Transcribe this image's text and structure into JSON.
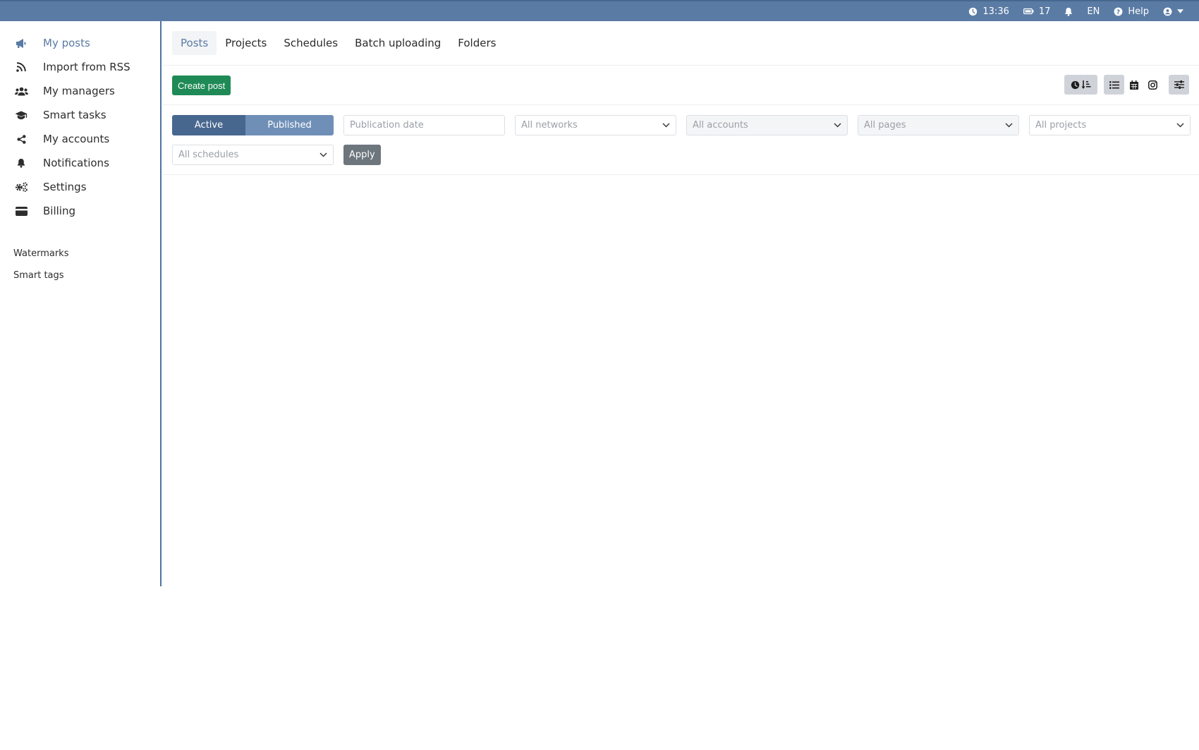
{
  "topbar": {
    "time": "13:36",
    "credits": "17",
    "language": "EN",
    "help": "Help"
  },
  "sidebar": {
    "items": [
      {
        "label": "My posts",
        "icon": "megaphone-icon",
        "active": true
      },
      {
        "label": "Import from RSS",
        "icon": "rss-icon"
      },
      {
        "label": "My managers",
        "icon": "users-icon"
      },
      {
        "label": "Smart tasks",
        "icon": "graduation-cap-icon"
      },
      {
        "label": "My accounts",
        "icon": "share-icon"
      },
      {
        "label": "Notifications",
        "icon": "bell-icon"
      },
      {
        "label": "Settings",
        "icon": "gears-icon"
      },
      {
        "label": "Billing",
        "icon": "credit-card-icon"
      }
    ],
    "extra": [
      {
        "label": "Watermarks"
      },
      {
        "label": "Smart tags"
      }
    ]
  },
  "tabs": [
    {
      "label": "Posts",
      "active": true
    },
    {
      "label": "Projects"
    },
    {
      "label": "Schedules"
    },
    {
      "label": "Batch uploading"
    },
    {
      "label": "Folders"
    }
  ],
  "toolbar": {
    "create_label": "Create post"
  },
  "filters": {
    "status_active": "Active",
    "status_published": "Published",
    "date_placeholder": "Publication date",
    "networks": "All networks",
    "accounts": "All accounts",
    "pages": "All pages",
    "projects": "All projects",
    "schedules": "All schedules",
    "apply_label": "Apply"
  },
  "colors": {
    "accent": "#5a7ba4",
    "create": "#1f8a56",
    "segment_active": "#48678f",
    "segment_inactive": "#6f8fb7"
  }
}
